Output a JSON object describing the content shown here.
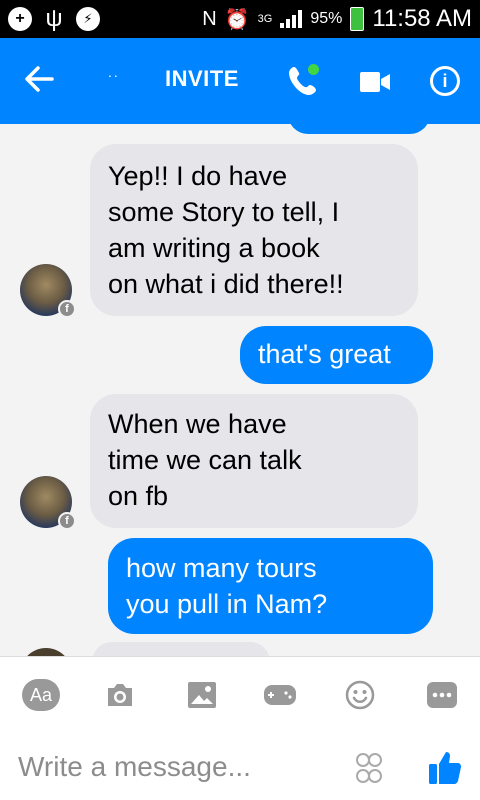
{
  "status_bar": {
    "network": "3G",
    "battery": "95%",
    "time": "11:58 AM",
    "icons": [
      "plus-icon",
      "usb-icon",
      "messenger-icon",
      "nfc-icon",
      "alarm-icon",
      "signal-icon",
      "battery-icon"
    ]
  },
  "header": {
    "title_dots": "..",
    "invite_label": "INVITE",
    "icons": [
      "back-arrow-icon",
      "phone-icon",
      "video-icon",
      "info-icon"
    ],
    "accent": "#0084ff",
    "online_color": "#42d742"
  },
  "messages": [
    {
      "direction": "in",
      "lines": [
        "Yep!! I do have",
        "some Story to tell, I",
        "am writing a book",
        "on what i did there!!"
      ]
    },
    {
      "direction": "out",
      "lines": [
        "that's great"
      ]
    },
    {
      "direction": "in",
      "lines": [
        "When we have",
        "time we can talk",
        "on fb"
      ]
    },
    {
      "direction": "out",
      "lines": [
        "how  many tours",
        "you pull in Nam?"
      ]
    }
  ],
  "composer": {
    "aa_label": "Aa",
    "placeholder": "Write a message...",
    "tools": [
      "text-format-icon",
      "camera-icon",
      "gallery-icon",
      "games-icon",
      "emoji-icon",
      "more-icon"
    ],
    "send_icons": [
      "stickers-icon",
      "like-icon"
    ]
  }
}
